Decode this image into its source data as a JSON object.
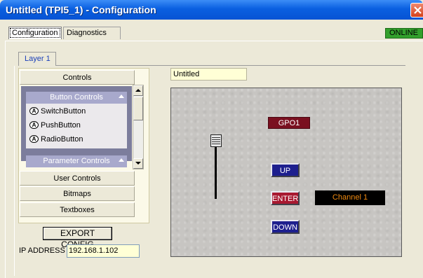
{
  "window": {
    "title": "Untitled (TPI5_1) - Configuration"
  },
  "tabs": [
    {
      "label": "Configuration"
    },
    {
      "label": "Diagnostics"
    }
  ],
  "status": {
    "label": "ONLINE",
    "color": "#33a02c"
  },
  "layer_tab": {
    "label": "Layer 1"
  },
  "controls_panel": {
    "header": "Controls",
    "button_controls": {
      "header": "Button Controls",
      "items": [
        "SwitchButton",
        "PushButton",
        "RadioButton"
      ]
    },
    "parameter_controls": {
      "header": "Parameter Controls"
    },
    "sections": [
      "User Controls",
      "Bitmaps",
      "Textboxes"
    ]
  },
  "export_button": {
    "label": "EXPORT CONFIG"
  },
  "ip": {
    "label": "IP ADDRESS",
    "value": "192.168.1.102"
  },
  "canvas": {
    "name_value": "Untitled",
    "gpo_label": "GPO1",
    "buttons": [
      {
        "label": "UP",
        "color": "#1d1f8e"
      },
      {
        "label": "ENTER",
        "color": "#a81830"
      },
      {
        "label": "DOWN",
        "color": "#1d1f8e"
      }
    ],
    "channel_display": {
      "text": "Channel 1",
      "text_color": "#f08a10"
    }
  },
  "icons": {
    "close": "close-icon",
    "badge": "button-a-icon"
  }
}
